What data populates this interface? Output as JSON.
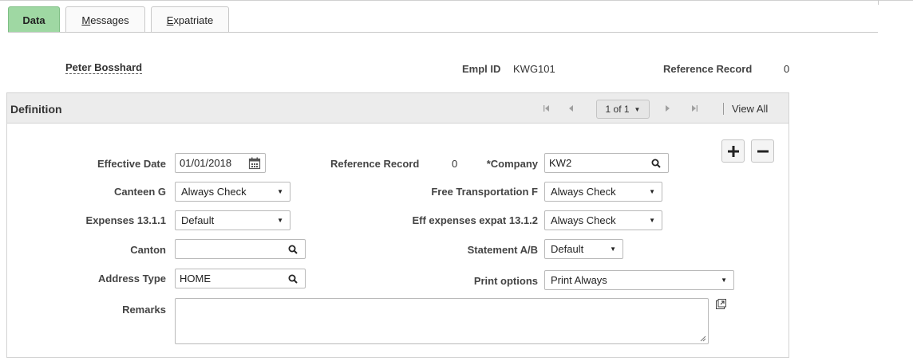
{
  "tabs": [
    {
      "label": "Data",
      "active": true
    },
    {
      "label_u": "M",
      "label_rest": "essages",
      "active": false
    },
    {
      "label_u": "E",
      "label_rest": "xpatriate",
      "active": false
    }
  ],
  "header": {
    "name": "Peter Bosshard",
    "empl_id_label": "Empl ID",
    "empl_id": "KWG101",
    "ref_record_label": "Reference Record",
    "ref_record_value": "0"
  },
  "definition": {
    "title": "Definition",
    "pager": "1 of 1",
    "view_all": "View All"
  },
  "form": {
    "effective_date_label": "Effective Date",
    "effective_date": "01/01/2018",
    "reference_record_label": "Reference Record",
    "reference_record_value": "0",
    "company_label": "*Company",
    "company": "KW2",
    "canteen_label": "Canteen G",
    "canteen": "Always Check",
    "free_transport_label": "Free Transportation F",
    "free_transport": "Always Check",
    "expenses_label": "Expenses 13.1.1",
    "expenses": "Default",
    "eff_expenses_label": "Eff expenses expat 13.1.2",
    "eff_expenses": "Always Check",
    "canton_label": "Canton",
    "canton": "",
    "statement_label": "Statement A/B",
    "statement": "Default",
    "address_type_label": "Address Type",
    "address_type": "HOME",
    "print_options_label": "Print options",
    "print_options": "Print Always",
    "remarks_label": "Remarks",
    "remarks": ""
  },
  "colors": {
    "active_tab": "#9fd8a3",
    "group_header": "#ececec"
  },
  "icons": [
    "calendar-icon",
    "search-icon",
    "dropdown-arrow-icon",
    "first-page-icon",
    "previous-page-icon",
    "next-page-icon",
    "last-page-icon",
    "add-row-icon",
    "delete-row-icon",
    "expand-textarea-icon"
  ]
}
